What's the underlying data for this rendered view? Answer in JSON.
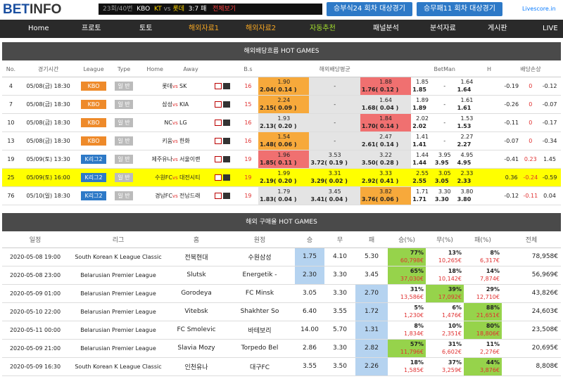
{
  "logo": {
    "part1": "BET",
    "part2": "INFO"
  },
  "ticker": {
    "round": "23회/40번",
    "home": "KBO",
    "team1": "KT",
    "vs": "vs",
    "team2": "롯데",
    "score": "3:7",
    "status": "패",
    "link": "전체보기"
  },
  "top_buttons": [
    "승부식24 회차 대상경기",
    "승무패11 회차 대상경기"
  ],
  "livescore": "Livescore.in",
  "nav": [
    "Home",
    "프로토",
    "토토",
    "해외자료1",
    "해외자료2",
    "자동추천",
    "패널분석",
    "분석자료",
    "게시판",
    "LIVE"
  ],
  "section1": "해외배당흐름 HOT GAMES",
  "section2": "해외 구매율 HOT GAMES",
  "t1_headers": [
    "No.",
    "경기시간",
    "League",
    "Type",
    "Home",
    "Away",
    "",
    "B.s",
    "해외배당평균",
    "",
    "",
    "BetMan",
    "",
    "",
    "H",
    "배당손상",
    "",
    ""
  ],
  "games": [
    {
      "no": "4",
      "time": "05/08(금) 18:30",
      "league": "KBO",
      "type": "일 반",
      "home": "롯데",
      "away": "SK",
      "bs": "16",
      "o1t": "1.90",
      "o1b": "2.04( 0.14 )",
      "o2": "-",
      "o3t": "1.88",
      "o3b": "1.76( 0.12 )",
      "bm1t": "1.85",
      "bm1b": "1.85",
      "bm2": "-",
      "bm3t": "1.64",
      "bm3b": "1.64",
      "d1": "-0.19",
      "d2": "0",
      "d3": "-0.12"
    },
    {
      "no": "7",
      "time": "05/08(금) 18:30",
      "league": "KBO",
      "type": "일 반",
      "home": "삼성",
      "away": "KIA",
      "bs": "15",
      "o1t": "2.24",
      "o1b": "2.15( 0.09 )",
      "o2": "-",
      "o3t": "1.64",
      "o3b": "1.68( 0.04 )",
      "bm1t": "1.89",
      "bm1b": "1.89",
      "bm2": "-",
      "bm3t": "1.61",
      "bm3b": "1.61",
      "d1": "-0.26",
      "d2": "0",
      "d3": "-0.07"
    },
    {
      "no": "10",
      "time": "05/08(금) 18:30",
      "league": "KBO",
      "type": "일 반",
      "home": "NC",
      "away": "LG",
      "bs": "16",
      "o1t": "1.93",
      "o1b": "2.13( 0.20 )",
      "o2": "-",
      "o3t": "1.84",
      "o3b": "1.70( 0.14 )",
      "bm1t": "2.02",
      "bm1b": "2.02",
      "bm2": "-",
      "bm3t": "1.53",
      "bm3b": "1.53",
      "d1": "-0.11",
      "d2": "0",
      "d3": "-0.17"
    },
    {
      "no": "13",
      "time": "05/08(금) 18:30",
      "league": "KBO",
      "type": "일 반",
      "home": "키움",
      "away": "한화",
      "bs": "16",
      "o1t": "1.54",
      "o1b": "1.48( 0.06 )",
      "o2": "-",
      "o3t": "2.47",
      "o3b": "2.61( 0.14 )",
      "bm1t": "1.41",
      "bm1b": "1.41",
      "bm2": "-",
      "bm3t": "2.27",
      "bm3b": "2.27",
      "d1": "-0.07",
      "d2": "0",
      "d3": "-0.34"
    },
    {
      "no": "19",
      "time": "05/09(토) 13:30",
      "league": "K리그2",
      "type": "일 반",
      "home": "제주유나",
      "away": "서울이랜",
      "bs": "19",
      "o1t": "1.96",
      "o1b": "1.85( 0.11 )",
      "o2t": "3.53",
      "o2b": "3.72( 0.19 )",
      "o3t": "3.22",
      "o3b": "3.50( 0.28 )",
      "bm1t": "1.44",
      "bm1b": "1.44",
      "bm2t": "3.95",
      "bm2b": "3.95",
      "bm3t": "4.95",
      "bm3b": "4.95",
      "d1": "-0.41",
      "d2": "0.23",
      "d3": "1.45"
    },
    {
      "no": "25",
      "time": "05/09(토) 16:00",
      "league": "K리그2",
      "type": "일 반",
      "home": "수원FC",
      "away": "대전시티",
      "bs": "19",
      "o1t": "1.99",
      "o1b": "2.19( 0.20 )",
      "o2t": "3.31",
      "o2b": "3.29( 0.02 )",
      "o3t": "3.33",
      "o3b": "2.92( 0.41 )",
      "bm1t": "2.55",
      "bm1b": "2.55",
      "bm2t": "3.05",
      "bm2b": "3.05",
      "bm3t": "2.33",
      "bm3b": "2.33",
      "d1": "0.36",
      "d2": "-0.24",
      "d3": "-0.59"
    },
    {
      "no": "76",
      "time": "05/10(일) 18:30",
      "league": "K리그2",
      "type": "일 반",
      "home": "경남FC",
      "away": "전남드래",
      "bs": "19",
      "o1t": "1.79",
      "o1b": "1.83( 0.04 )",
      "o2t": "3.45",
      "o2b": "3.41( 0.04 )",
      "o3t": "3.82",
      "o3b": "3.76( 0.06 )",
      "bm1t": "1.71",
      "bm1b": "1.71",
      "bm2t": "3.30",
      "bm2b": "3.30",
      "bm3t": "3.80",
      "bm3b": "3.80",
      "d1": "-0.12",
      "d2": "-0.11",
      "d3": "0.04"
    }
  ],
  "t2_headers": [
    "일정",
    "리그",
    "홈",
    "원정",
    "승",
    "무",
    "패",
    "승(%)",
    "무(%)",
    "패(%)",
    "전체"
  ],
  "purchases": [
    {
      "date": "2020-05-08 19:00",
      "league": "South Korean K League Classic",
      "home": "전북현대",
      "away": "수원삼성",
      "w": "1.75",
      "d": "4.10",
      "l": "5.30",
      "wp": "77%",
      "wn": "60,798€",
      "dp": "13%",
      "dn": "10,265€",
      "lp": "8%",
      "ln": "6,317€",
      "total": "78,958€"
    },
    {
      "date": "2020-05-08 23:00",
      "league": "Belarusian Premier League",
      "home": "Slutsk",
      "away": "Energetik -",
      "w": "2.30",
      "d": "3.30",
      "l": "3.45",
      "wp": "65%",
      "wn": "37,030€",
      "dp": "18%",
      "dn": "10,142€",
      "lp": "14%",
      "ln": "7,874€",
      "total": "56,969€"
    },
    {
      "date": "2020-05-09 01:00",
      "league": "Belarusian Premier League",
      "home": "Gorodeya",
      "away": "FC Minsk",
      "w": "3.05",
      "d": "3.30",
      "l": "2.70",
      "wp": "31%",
      "wn": "13,586€",
      "dp": "39%",
      "dn": "17,092€",
      "lp": "29%",
      "ln": "12,710€",
      "total": "43,826€"
    },
    {
      "date": "2020-05-10 22:00",
      "league": "Belarusian Premier League",
      "home": "Vitebsk",
      "away": "Shakhter So",
      "w": "6.40",
      "d": "3.55",
      "l": "1.72",
      "wp": "5%",
      "wn": "1,230€",
      "dp": "6%",
      "dn": "1,476€",
      "lp": "88%",
      "ln": "21,651€",
      "total": "24,603€"
    },
    {
      "date": "2020-05-11 00:00",
      "league": "Belarusian Premier League",
      "home": "FC Smolevic",
      "away": "바테보리",
      "w": "14.00",
      "d": "5.70",
      "l": "1.31",
      "wp": "8%",
      "wn": "1,834€",
      "dp": "10%",
      "dn": "2,351€",
      "lp": "80%",
      "ln": "18,806€",
      "total": "23,508€"
    },
    {
      "date": "2020-05-09 21:00",
      "league": "Belarusian Premier League",
      "home": "Slavia Mozy",
      "away": "Torpedo Bel",
      "w": "2.86",
      "d": "3.30",
      "l": "2.82",
      "wp": "57%",
      "wn": "11,796€",
      "dp": "31%",
      "dn": "6,602€",
      "lp": "11%",
      "ln": "2,276€",
      "total": "20,695€"
    },
    {
      "date": "2020-05-09 16:30",
      "league": "South Korean K League Classic",
      "home": "인천유나",
      "away": "대구FC",
      "w": "3.55",
      "d": "3.50",
      "l": "2.26",
      "wp": "18%",
      "wn": "1,585€",
      "dp": "37%",
      "dn": "3,259€",
      "lp": "44%",
      "ln": "3,876€",
      "total": "8,808€"
    }
  ]
}
